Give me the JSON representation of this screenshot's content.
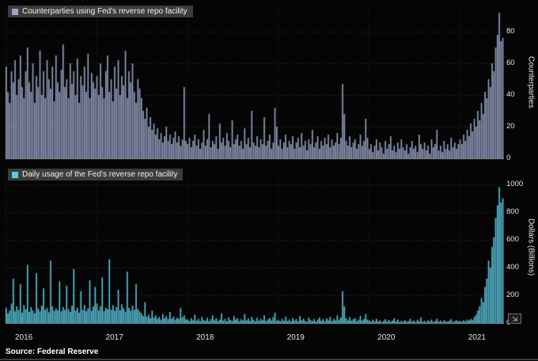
{
  "source": "Source: Federal Reserve",
  "x_axis": {
    "labels": [
      "2016",
      "2017",
      "2018",
      "2019",
      "2020",
      "2021"
    ]
  },
  "tool_icon": "⇲",
  "panels": [
    {
      "legend": "Counterparties using Fed's reverse repo facility",
      "axis_title": "Counterparties",
      "color": "#9aa5c8",
      "ticks": [
        0,
        20,
        40,
        60,
        80
      ]
    },
    {
      "legend": "Daily usage of the Fed's reverse repo facility",
      "axis_title": "Dollars (Billions)",
      "color": "#5bcbe3",
      "ticks": [
        0,
        200,
        400,
        600,
        800,
        1000
      ]
    }
  ],
  "chart_data": [
    {
      "type": "bar",
      "title": "Counterparties using Fed's reverse repo facility",
      "xlabel": "",
      "ylabel": "Counterparties",
      "x_range": [
        "2016-01",
        "2021-06"
      ],
      "ylim": [
        0,
        98
      ],
      "grid": true,
      "legend_position": "top-left",
      "values": [
        58,
        42,
        35,
        55,
        48,
        62,
        40,
        50,
        65,
        45,
        38,
        55,
        70,
        48,
        42,
        60,
        35,
        52,
        45,
        68,
        40,
        55,
        38,
        62,
        50,
        44,
        58,
        36,
        65,
        48,
        42,
        56,
        72,
        45,
        50,
        38,
        60,
        47,
        55,
        40,
        63,
        35,
        52,
        46,
        58,
        42,
        66,
        38,
        54,
        48,
        44,
        52,
        40,
        60,
        45,
        38,
        55,
        65,
        42,
        50,
        36,
        58,
        44,
        62,
        40,
        52,
        46,
        68,
        38,
        55,
        48,
        60,
        42,
        35,
        50,
        44,
        38,
        30,
        25,
        32,
        20,
        26,
        18,
        22,
        15,
        19,
        12,
        16,
        10,
        14,
        20,
        11,
        15,
        9,
        13,
        17,
        10,
        14,
        8,
        12,
        45,
        11,
        9,
        13,
        7,
        11,
        15,
        8,
        12,
        6,
        10,
        18,
        8,
        12,
        28,
        7,
        11,
        9,
        14,
        6,
        22,
        10,
        13,
        8,
        16,
        11,
        7,
        24,
        9,
        12,
        15,
        8,
        11,
        6,
        19,
        9,
        13,
        7,
        30,
        10,
        8,
        14,
        7,
        12,
        9,
        26,
        8,
        11,
        15,
        6,
        10,
        32,
        20,
        8,
        12,
        6,
        10,
        15,
        7,
        11,
        9,
        14,
        6,
        10,
        13,
        7,
        16,
        8,
        11,
        5,
        12,
        9,
        18,
        7,
        10,
        14,
        6,
        11,
        8,
        13,
        9,
        15,
        7,
        12,
        8,
        10,
        16,
        9,
        13,
        47,
        28,
        11,
        8,
        14,
        7,
        10,
        12,
        6,
        9,
        15,
        8,
        11,
        25,
        13,
        6,
        9,
        4,
        8,
        12,
        5,
        10,
        7,
        3,
        11,
        6,
        9,
        14,
        5,
        8,
        4,
        10,
        6,
        12,
        7,
        5,
        9,
        3,
        7,
        11,
        6,
        8,
        4,
        15,
        9,
        6,
        10,
        5,
        8,
        3,
        12,
        7,
        9,
        18,
        5,
        8,
        4,
        11,
        6,
        9,
        5,
        13,
        7,
        10,
        6,
        9,
        12,
        9,
        15,
        11,
        18,
        14,
        22,
        17,
        25,
        20,
        30,
        24,
        35,
        28,
        42,
        38,
        50,
        45,
        60,
        55,
        70,
        78,
        92,
        74,
        76
      ]
    },
    {
      "type": "bar",
      "title": "Daily usage of the Fed's reverse repo facility",
      "xlabel": "",
      "ylabel": "Dollars (Billions)",
      "x_range": [
        "2016-01",
        "2021-06"
      ],
      "ylim": [
        0,
        1120
      ],
      "grid": true,
      "legend_position": "top-left",
      "values": [
        110,
        70,
        90,
        140,
        320,
        85,
        120,
        95,
        280,
        75,
        130,
        100,
        420,
        80,
        115,
        90,
        70,
        360,
        105,
        85,
        125,
        250,
        95,
        110,
        78,
        450,
        120,
        88,
        105,
        92,
        300,
        85,
        115,
        95,
        270,
        100,
        80,
        125,
        390,
        90,
        110,
        75,
        230,
        95,
        130,
        85,
        105,
        310,
        88,
        120,
        260,
        140,
        90,
        120,
        330,
        85,
        110,
        100,
        460,
        95,
        130,
        88,
        115,
        240,
        92,
        135,
        105,
        80,
        370,
        110,
        90,
        125,
        95,
        280,
        100,
        85,
        70,
        50,
        150,
        45,
        60,
        35,
        90,
        40,
        55,
        30,
        45,
        25,
        65,
        35,
        50,
        28,
        80,
        32,
        46,
        24,
        38,
        30,
        110,
        42,
        55,
        26,
        25,
        15,
        35,
        20,
        60,
        18,
        30,
        12,
        45,
        22,
        16,
        38,
        14,
        28,
        55,
        20,
        35,
        15,
        25,
        70,
        18,
        30,
        12,
        40,
        22,
        16,
        50,
        25,
        35,
        14,
        28,
        18,
        65,
        20,
        32,
        15,
        45,
        24,
        12,
        38,
        16,
        30,
        20,
        55,
        14,
        26,
        35,
        18,
        42,
        75,
        15,
        22,
        12,
        30,
        16,
        45,
        14,
        25,
        10,
        35,
        18,
        28,
        12,
        50,
        20,
        32,
        15,
        8,
        38,
        22,
        14,
        30,
        10,
        25,
        40,
        16,
        28,
        12,
        35,
        20,
        45,
        15,
        30,
        18,
        55,
        25,
        40,
        230,
        120,
        35,
        20,
        42,
        16,
        28,
        35,
        12,
        24,
        50,
        18,
        30,
        65,
        25,
        18,
        8,
        25,
        12,
        30,
        10,
        20,
        6,
        15,
        28,
        10,
        22,
        8,
        18,
        35,
        12,
        25,
        6,
        16,
        10,
        20,
        8,
        14,
        30,
        10,
        18,
        6,
        24,
        12,
        40,
        9,
        16,
        6,
        20,
        11,
        25,
        8,
        14,
        32,
        10,
        18,
        6,
        22,
        12,
        9,
        16,
        28,
        8,
        14,
        20,
        12,
        15,
        8,
        20,
        12,
        25,
        18,
        30,
        22,
        45,
        60,
        90,
        120,
        180,
        150,
        260,
        320,
        450,
        400,
        550,
        620,
        760,
        850,
        980,
        870,
        900
      ]
    }
  ]
}
